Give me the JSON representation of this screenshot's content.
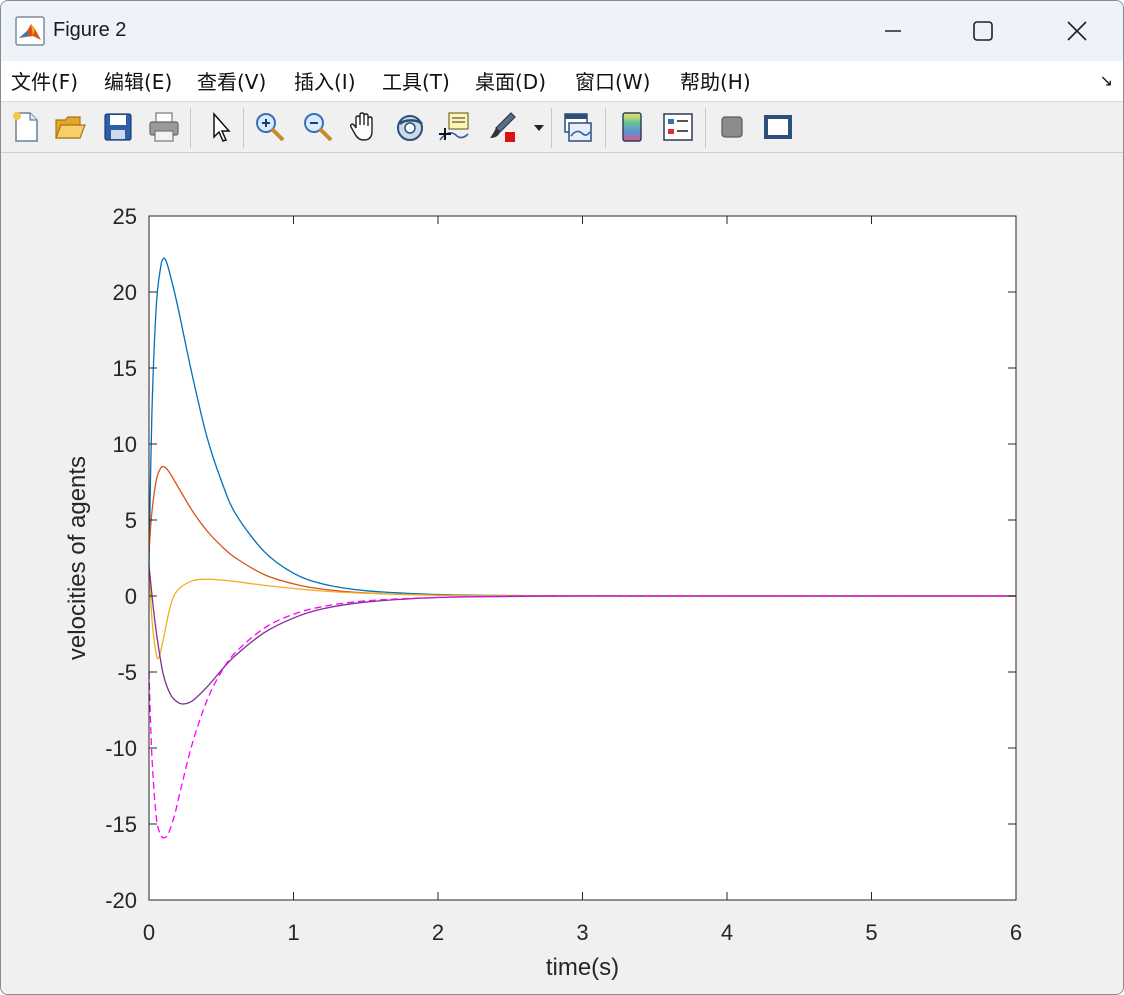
{
  "window": {
    "title": "Figure 2"
  },
  "menu": [
    "文件(F)",
    "编辑(E)",
    "查看(V)",
    "插入(I)",
    "工具(T)",
    "桌面(D)",
    "窗口(W)",
    "帮助(H)"
  ],
  "menu_overflow_icon": "arrow-down-right",
  "toolbar_icons": [
    "new-figure-icon",
    "open-file-icon",
    "save-icon",
    "print-icon",
    "select-arrow-icon",
    "zoom-in-icon",
    "zoom-out-icon",
    "pan-hand-icon",
    "rotate-3d-icon",
    "data-cursor-icon",
    "brush-icon",
    "brush-dropdown-icon",
    "link-plot-icon",
    "colorbar-icon",
    "legend-icon",
    "hide-plot-tools-icon",
    "show-plot-tools-icon"
  ],
  "chart_data": {
    "type": "line",
    "title": "",
    "xlabel": "time(s)",
    "ylabel": "velocities of agents",
    "xlim": [
      0,
      6
    ],
    "ylim": [
      -20,
      25
    ],
    "xticks": [
      "0",
      "1",
      "2",
      "3",
      "4",
      "5",
      "6"
    ],
    "yticks": [
      "-20",
      "-15",
      "-10",
      "-5",
      "0",
      "5",
      "10",
      "15",
      "20",
      "25"
    ],
    "grid": false,
    "legend": "none",
    "series": [
      {
        "color": "#0072bd",
        "style": "solid",
        "x": [
          0,
          0.02,
          0.05,
          0.08,
          0.1,
          0.12,
          0.15,
          0.2,
          0.3,
          0.4,
          0.5,
          0.6,
          0.8,
          1.0,
          1.2,
          1.5,
          2.0,
          2.5,
          3.0,
          4.0,
          5.0,
          6.0
        ],
        "y": [
          2,
          12,
          19,
          21.6,
          22.2,
          22,
          21,
          19,
          14.5,
          10.5,
          7.6,
          5.4,
          2.9,
          1.5,
          0.8,
          0.35,
          0.1,
          0.03,
          0.01,
          0,
          0,
          0
        ]
      },
      {
        "color": "#d95319",
        "style": "solid",
        "x": [
          0,
          0.02,
          0.05,
          0.08,
          0.1,
          0.12,
          0.15,
          0.2,
          0.3,
          0.4,
          0.5,
          0.6,
          0.8,
          1.0,
          1.2,
          1.5,
          2.0,
          2.5,
          3.0,
          4.0,
          5.0,
          6.0
        ],
        "y": [
          3,
          5.5,
          7.6,
          8.4,
          8.5,
          8.4,
          8,
          7.2,
          5.6,
          4.3,
          3.3,
          2.5,
          1.4,
          0.8,
          0.45,
          0.2,
          0.05,
          0.01,
          0,
          0,
          0,
          0
        ]
      },
      {
        "color": "#edb120",
        "style": "solid",
        "x": [
          0,
          0.02,
          0.05,
          0.07,
          0.1,
          0.15,
          0.2,
          0.3,
          0.4,
          0.5,
          0.6,
          0.8,
          1.0,
          1.2,
          1.5,
          2.0,
          2.5,
          3.0,
          4.0,
          5.0,
          6.0
        ],
        "y": [
          2,
          -1.5,
          -3.8,
          -4,
          -2.8,
          -0.6,
          0.4,
          1,
          1.1,
          1.05,
          0.95,
          0.7,
          0.5,
          0.33,
          0.18,
          0.05,
          0.01,
          0,
          0,
          0,
          0
        ]
      },
      {
        "color": "#7e2f8e",
        "style": "solid",
        "x": [
          0,
          0.03,
          0.06,
          0.1,
          0.15,
          0.2,
          0.24,
          0.3,
          0.4,
          0.5,
          0.6,
          0.8,
          1.0,
          1.2,
          1.5,
          2.0,
          2.5,
          3.0,
          4.0,
          5.0,
          6.0
        ],
        "y": [
          2,
          -0.8,
          -3,
          -5.2,
          -6.5,
          -7,
          -7.1,
          -6.9,
          -6,
          -4.9,
          -3.9,
          -2.4,
          -1.45,
          -0.85,
          -0.4,
          -0.1,
          -0.03,
          0,
          0,
          0,
          0
        ]
      },
      {
        "color": "#ff00ff",
        "style": "dashed",
        "x": [
          0,
          0.02,
          0.05,
          0.08,
          0.11,
          0.14,
          0.18,
          0.22,
          0.3,
          0.4,
          0.5,
          0.6,
          0.8,
          1.0,
          1.2,
          1.5,
          2.0,
          2.5,
          3.0,
          4.0,
          5.0,
          6.0
        ],
        "y": [
          -5,
          -10.5,
          -14.5,
          -15.7,
          -15.9,
          -15.5,
          -14.3,
          -12.7,
          -9.7,
          -6.9,
          -5,
          -3.7,
          -2.1,
          -1.2,
          -0.7,
          -0.32,
          -0.09,
          -0.02,
          0,
          0,
          0,
          0
        ]
      }
    ]
  }
}
